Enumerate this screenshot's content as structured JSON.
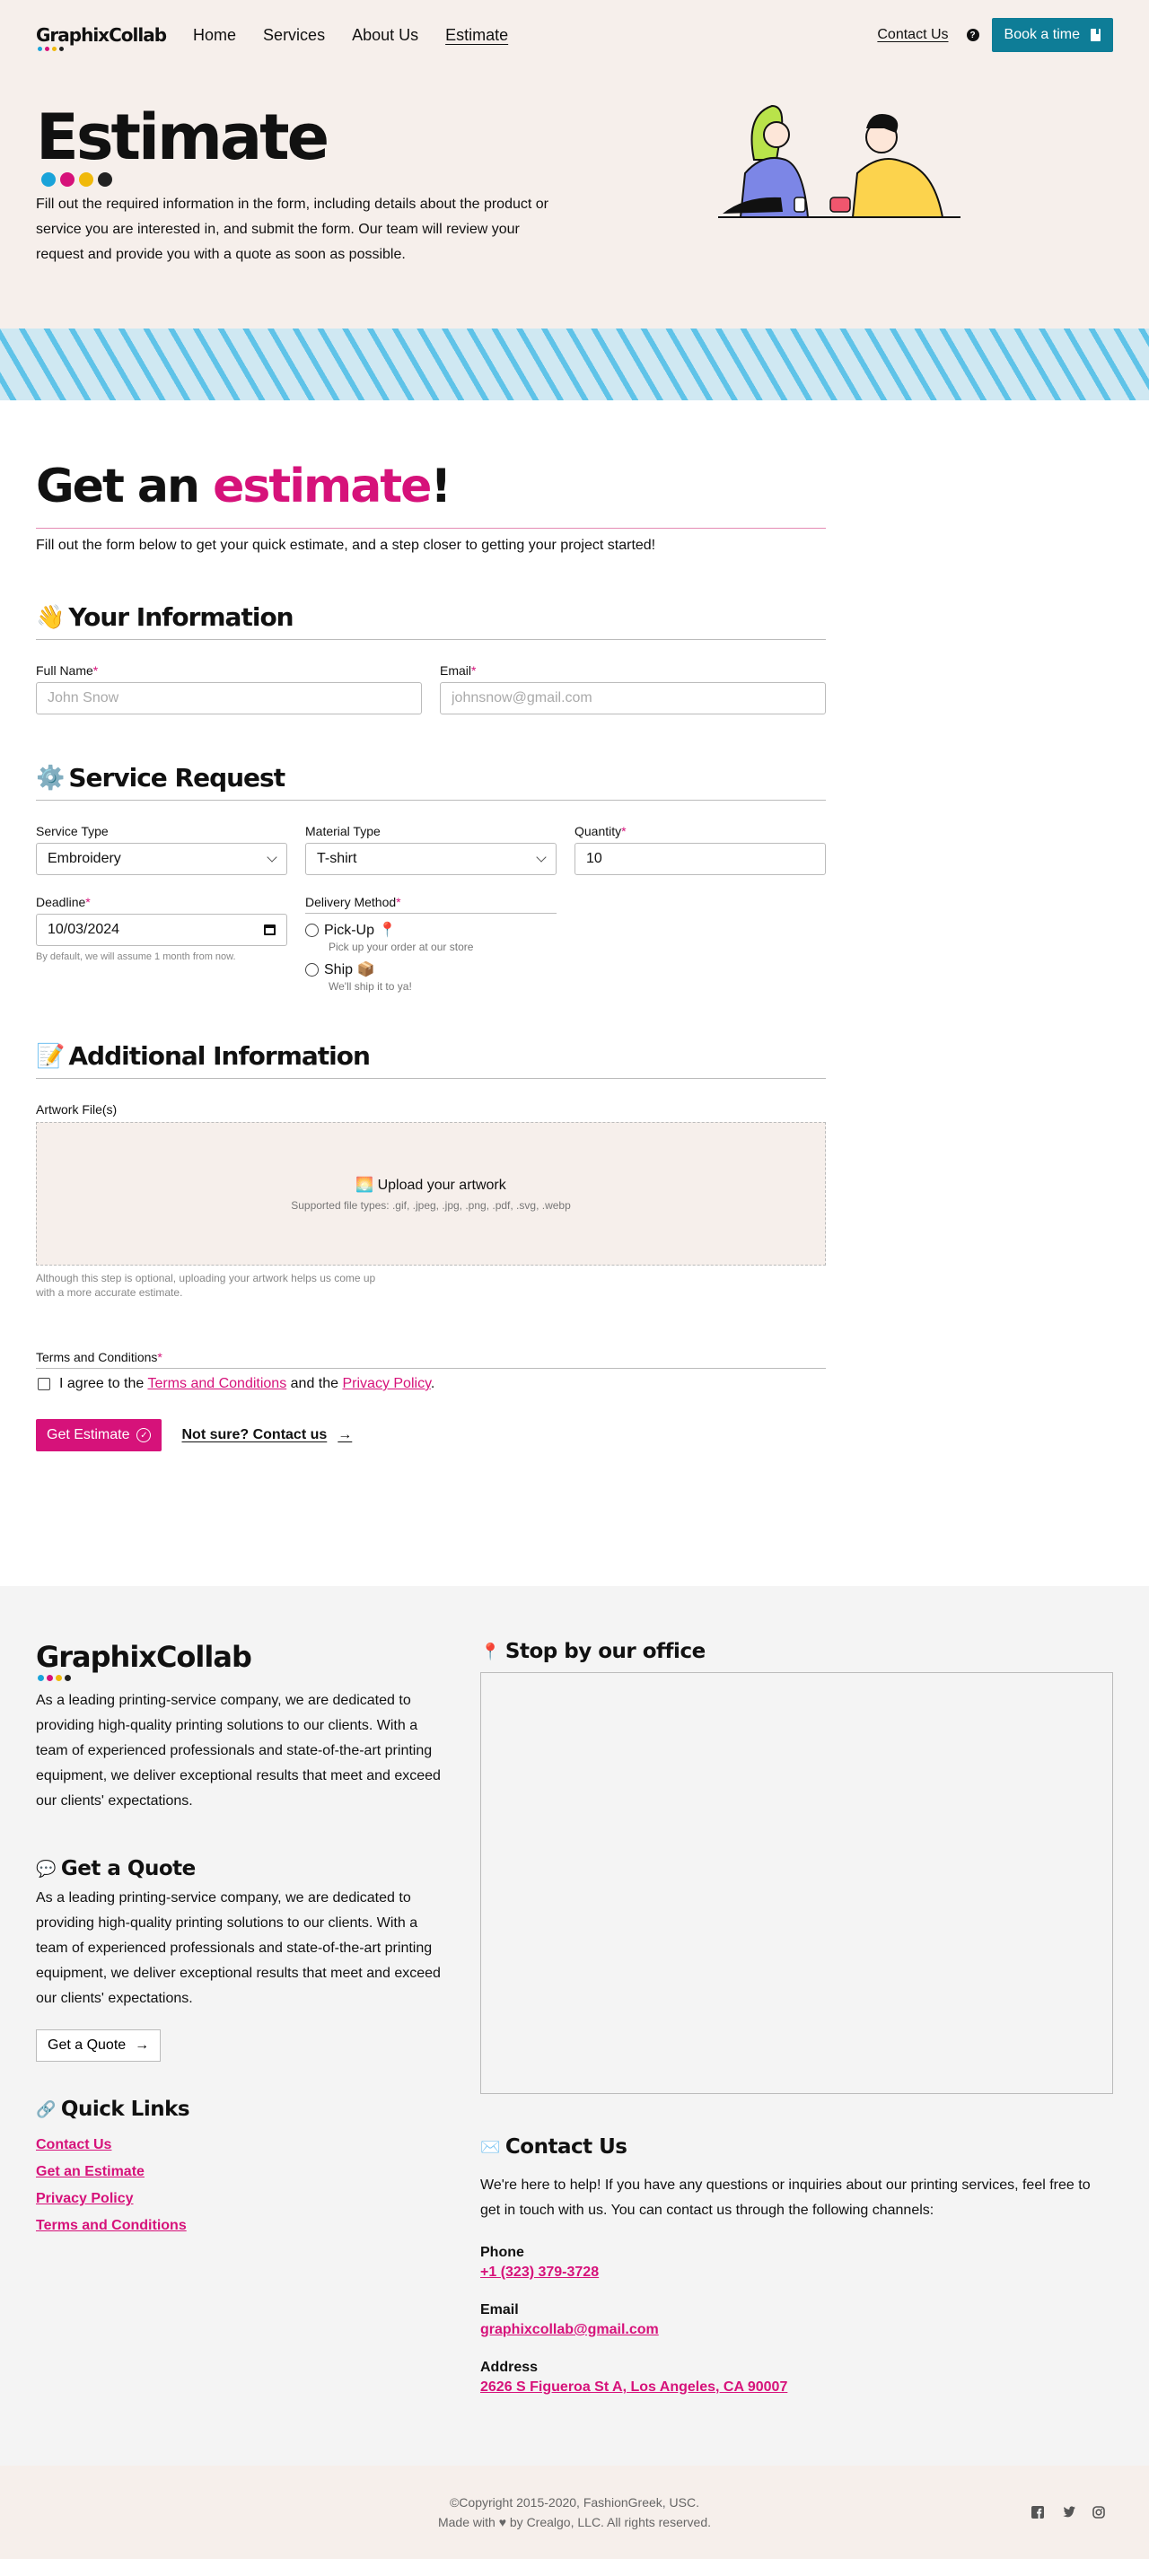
{
  "colors": {
    "brand_pink": "#d6127a",
    "teal": "#0e7d97",
    "cream": "#f6efeb",
    "dot1": "#1aa3d9",
    "dot2": "#d6127a",
    "dot3": "#f0b90b",
    "dot4": "#222222"
  },
  "nav": {
    "logo": "GraphixCollab",
    "links": [
      "Home",
      "Services",
      "About Us",
      "Estimate"
    ],
    "contact": "Contact Us",
    "book": "Book a time"
  },
  "hero": {
    "title": "Estimate",
    "description": "Fill out the required information in the form, including details about the product or service you are interested in, and submit the form. Our team will review your request and provide you with a quote as soon as possible."
  },
  "form": {
    "title_pre": "Get an ",
    "title_highlight": "estimate",
    "title_post": "!",
    "subtitle": "Fill out the form below to get your quick estimate, and a step closer to getting your project started!",
    "your_info": {
      "emoji": "👋",
      "title": "Your Information"
    },
    "full_name": {
      "label": "Full Name",
      "placeholder": "John Snow"
    },
    "email": {
      "label": "Email",
      "placeholder": "johnsnow@gmail.com"
    },
    "service_request": {
      "emoji": "⚙️",
      "title": "Service Request"
    },
    "service_type": {
      "label": "Service Type",
      "value": "Embroidery"
    },
    "material_type": {
      "label": "Material Type",
      "value": "T-shirt"
    },
    "quantity": {
      "label": "Quantity",
      "value": "10"
    },
    "deadline": {
      "label": "Deadline",
      "value": "10/03/2024",
      "hint": "By default, we will assume 1 month from now."
    },
    "delivery": {
      "label": "Delivery Method",
      "pickup": "Pick-Up 📍",
      "pickup_hint": "Pick up your order at our store",
      "ship": "Ship 📦",
      "ship_hint": "We'll ship it to ya!"
    },
    "additional": {
      "emoji": "📝",
      "title": "Additional Information"
    },
    "artwork": {
      "label": "Artwork File(s)",
      "upload": "🌅 Upload your artwork",
      "types": "Supported file types: .gif, .jpeg, .jpg, .png, .pdf, .svg, .webp",
      "note": "Although this step is optional, uploading your artwork helps us come up with a more accurate estimate."
    },
    "terms": {
      "label": "Terms and Conditions",
      "pre": "I agree to the ",
      "link1": "Terms and Conditions",
      "mid": " and the ",
      "link2": "Privacy Policy",
      "post": "."
    },
    "submit": "Get Estimate",
    "not_sure": "Not sure? Contact us"
  },
  "footer": {
    "logo": "GraphixCollab",
    "about": "As a leading printing-service company, we are dedicated to providing high-quality printing solutions to our clients. With a team of experienced professionals and state-of-the-art printing equipment, we deliver exceptional results that meet and exceed our clients' expectations.",
    "quote": {
      "emoji": "💬",
      "title": "Get a Quote",
      "text": "As a leading printing-service company, we are dedicated to providing high-quality printing solutions to our clients. With a team of experienced professionals and state-of-the-art printing equipment, we deliver exceptional results that meet and exceed our clients' expectations.",
      "button": "Get a Quote"
    },
    "quick_links": {
      "emoji": "🔗",
      "title": "Quick Links",
      "items": [
        "Contact Us",
        "Get an Estimate",
        "Privacy Policy",
        "Terms and Conditions"
      ]
    },
    "office": {
      "emoji": "📍",
      "title": "Stop by our office"
    },
    "contact": {
      "emoji": "✉️",
      "title": "Contact Us",
      "text": "We're here to help! If you have any questions or inquiries about our printing services, feel free to get in touch with us. You can contact us through the following channels:",
      "phone_label": "Phone",
      "phone": "+1 (323) 379-3728",
      "email_label": "Email",
      "email": "graphixcollab@gmail.com",
      "address_label": "Address",
      "address": "2626 S Figueroa St A, Los Angeles, CA 90007"
    }
  },
  "bottom": {
    "copyright": "©Copyright 2015-2020, FashionGreek, USC.",
    "made_with_pre": "Made with ",
    "made_with_post": " by Crealgo, LLC. All rights reserved.",
    "socials": [
      "facebook-icon",
      "twitter-icon",
      "instagram-icon"
    ]
  }
}
